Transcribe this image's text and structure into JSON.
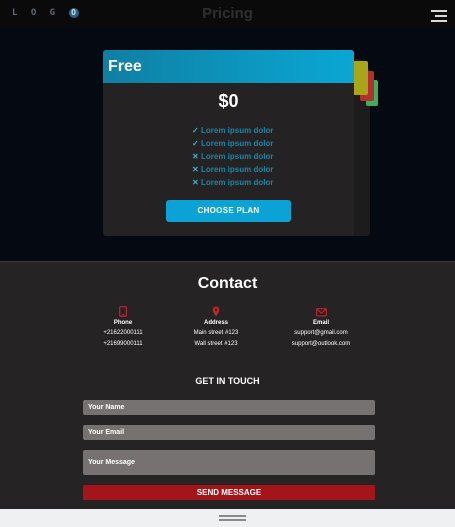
{
  "nav": {
    "logo": "LOGO",
    "title": "Pricing",
    "menu_icon": "hamburger-menu-icon"
  },
  "pricing": {
    "plan_name": "Free",
    "price": "$0",
    "features": [
      {
        "mark": "✓",
        "text": "Lorem ipsum dolor",
        "included": true
      },
      {
        "mark": "✓",
        "text": "Lorem ipsum dolor",
        "included": true
      },
      {
        "mark": "✕",
        "text": "Lorem ipsum dolor",
        "included": false
      },
      {
        "mark": "✕",
        "text": "Lorem ipsum dolor",
        "included": false
      },
      {
        "mark": "✕",
        "text": "Lorem ipsum dolor",
        "included": false
      }
    ],
    "cta": "CHOOSE PLAN",
    "accent": "#0ba3d6",
    "stack_tab_colors": [
      "#a8a51a",
      "#b3302f",
      "#3fae5a"
    ]
  },
  "contact": {
    "title": "Contact",
    "columns": [
      {
        "icon": "phone-icon",
        "label": "Phone",
        "values": [
          "+21622000111",
          "+21699000111"
        ]
      },
      {
        "icon": "location-pin-icon",
        "label": "Address",
        "values": [
          "Main street #123",
          "Wall street #123"
        ]
      },
      {
        "icon": "envelope-icon",
        "label": "Email",
        "values": [
          "support@gmail.com",
          "support@outlook.com"
        ]
      }
    ],
    "form_title": "GET IN TOUCH",
    "name_placeholder": "Your Name",
    "email_placeholder": "Your Email",
    "message_placeholder": "Your Message",
    "submit": "SEND MESSAGE",
    "icon_color": "#c8232a",
    "submit_color": "#a3141b"
  }
}
